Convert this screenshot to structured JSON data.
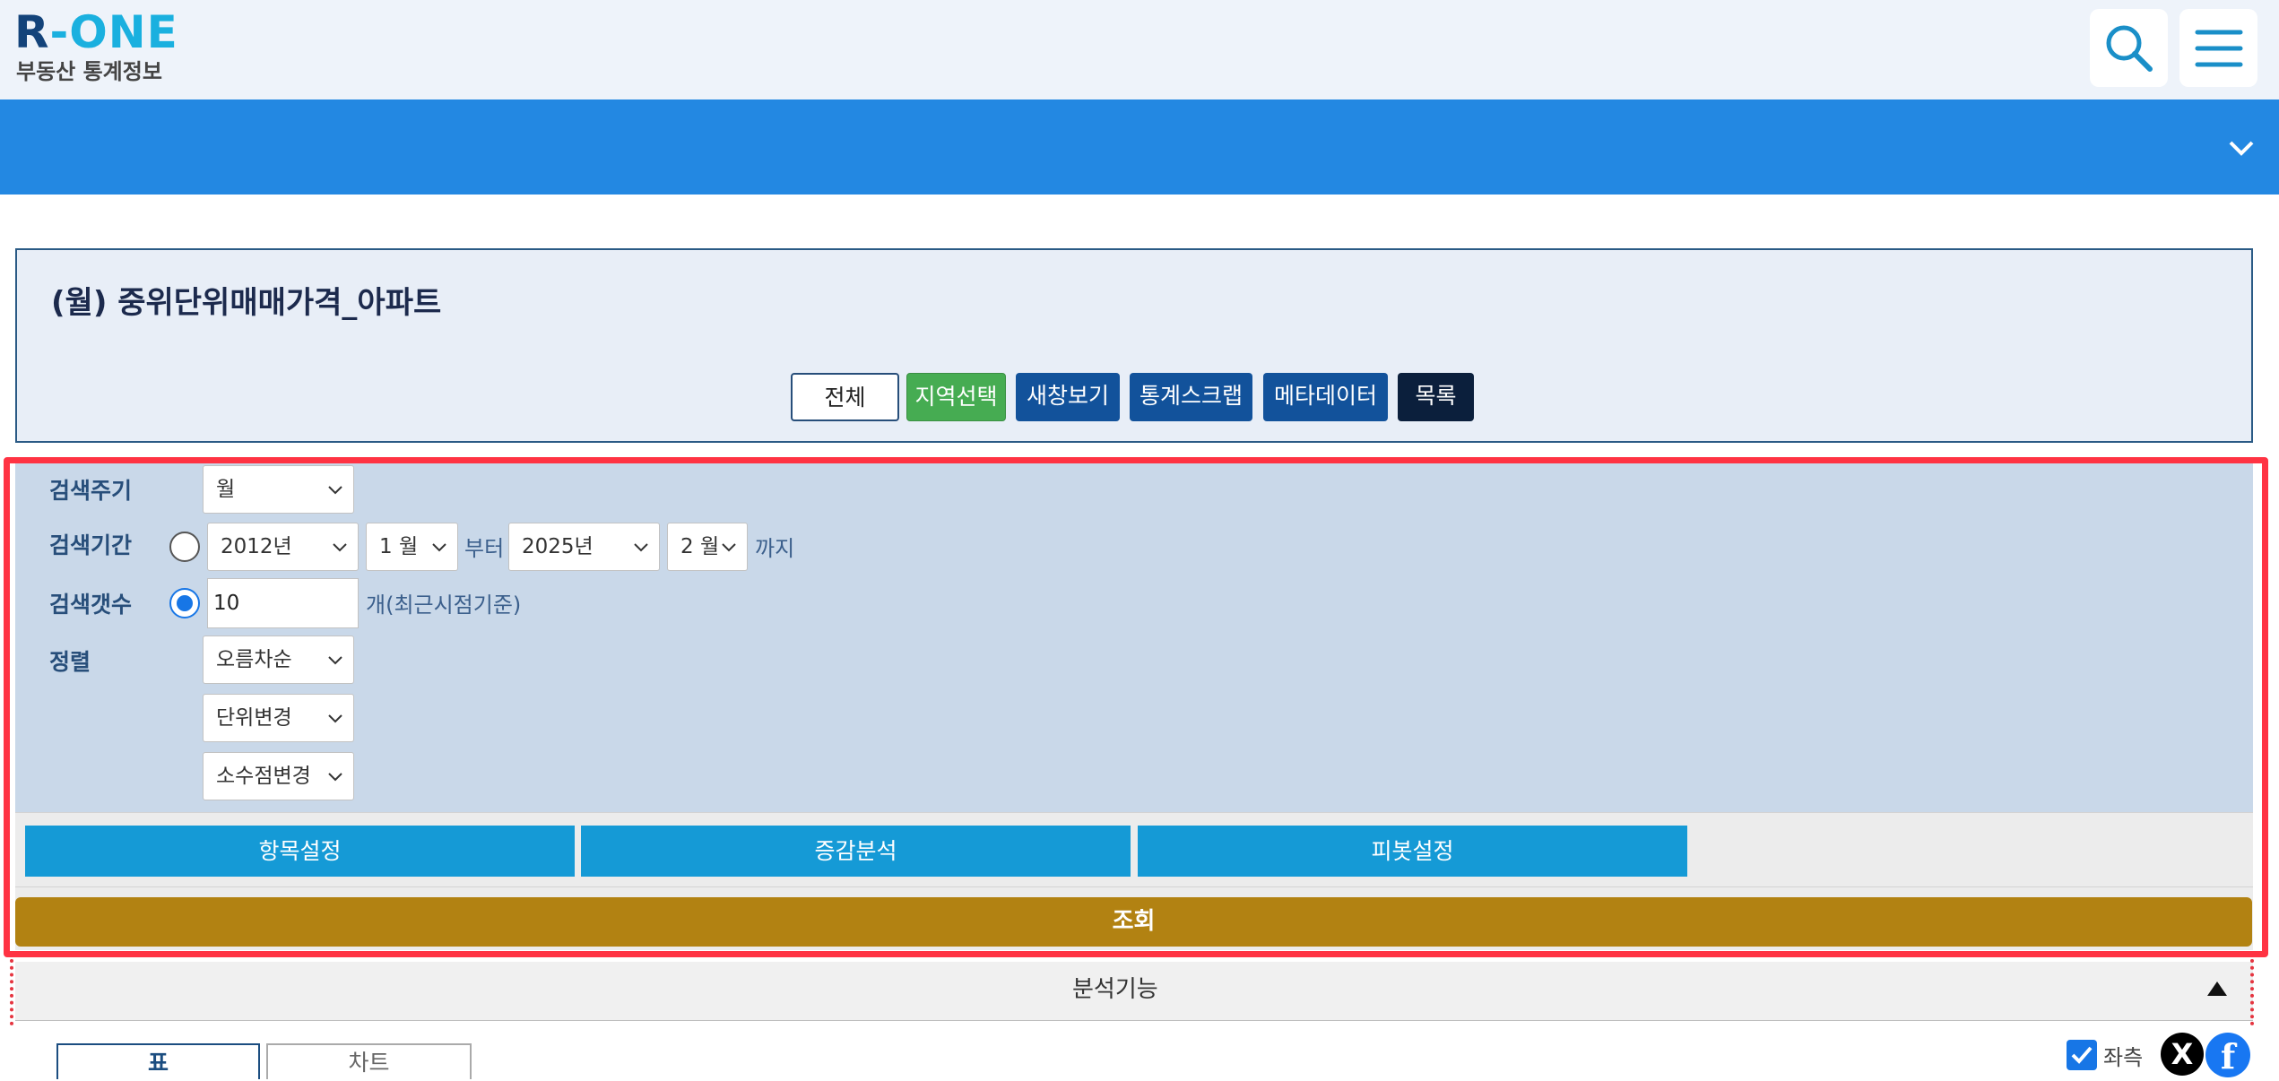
{
  "header": {
    "logo_r": "R",
    "logo_rest": "-ONE",
    "logo_sub": "부동산 통계정보",
    "search_icon": "search-icon",
    "menu_icon": "hamburger-icon"
  },
  "title_panel": {
    "title": "(월) 중위단위매매가격_아파트",
    "buttons": {
      "all": "전체",
      "region": "지역선택",
      "new_window": "새창보기",
      "scrap": "통계스크랩",
      "metadata": "메타데이터",
      "list": "목록"
    }
  },
  "search": {
    "cycle_label": "검색주기",
    "cycle_value": "월",
    "period_label": "검색기간",
    "period_start_year": "2012년",
    "period_start_month": "1 월",
    "from_text": "부터",
    "period_end_year": "2025년",
    "period_end_month": "2 월",
    "to_text": "까지",
    "count_label": "검색갯수",
    "count_value": "10",
    "count_suffix": "개(최근시점기준)",
    "sort_label": "정렬",
    "sort_value": "오름차순",
    "unit_value": "단위변경",
    "decimal_value": "소수점변경"
  },
  "actions": {
    "items": "항목설정",
    "change": "증감분석",
    "pivot": "피봇설정",
    "query": "조회"
  },
  "analysis": {
    "label": "분석기능"
  },
  "tabs": {
    "table": "표",
    "chart": "차트"
  },
  "footer_tools": {
    "left_fix_label": "좌측",
    "x_label": "X",
    "fb_label": "f"
  },
  "colors": {
    "nav_blue": "#2388e2",
    "highlight": "#ff3343",
    "query_gold": "#b28212",
    "action_blue": "#159ad6"
  }
}
